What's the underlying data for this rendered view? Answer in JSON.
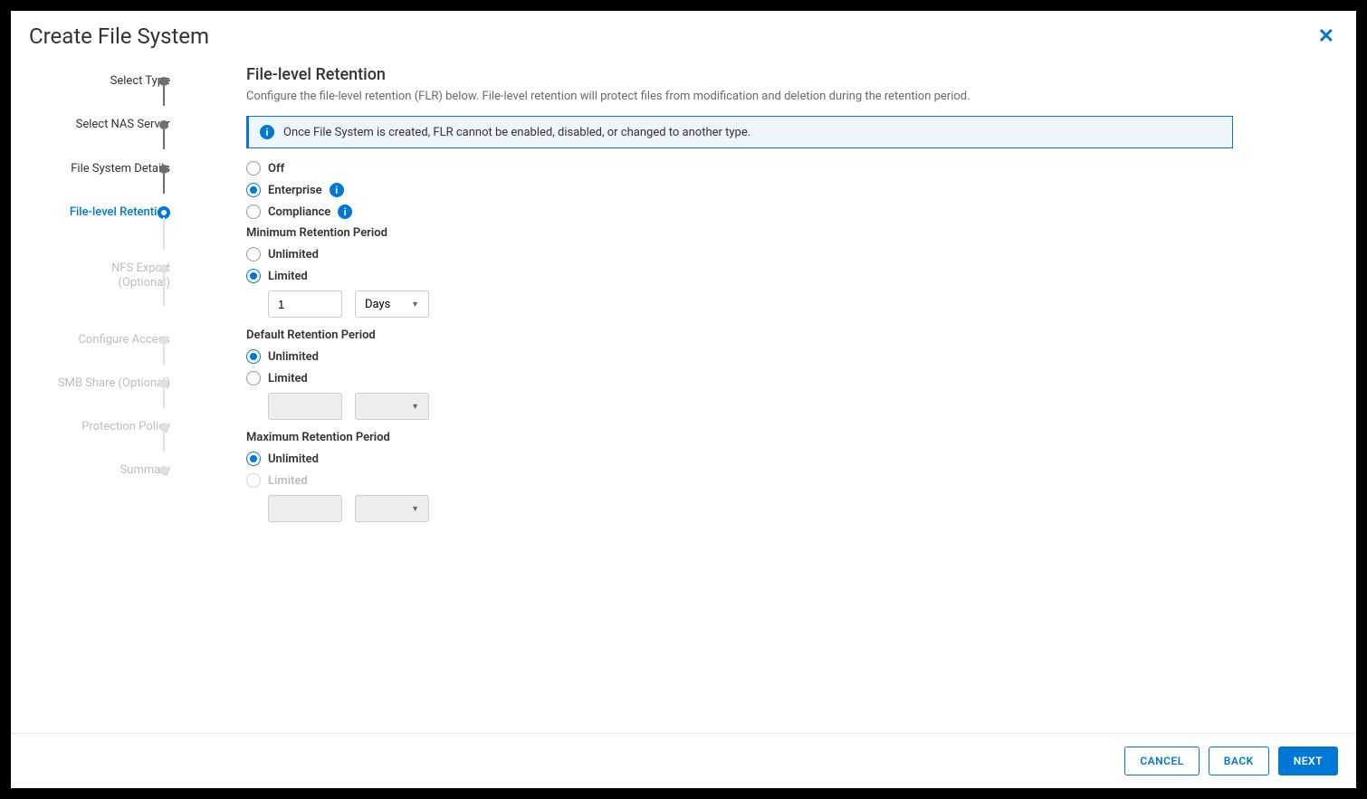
{
  "dialog": {
    "title": "Create File System"
  },
  "steps": [
    {
      "label": "Select Type"
    },
    {
      "label": "Select NAS Server"
    },
    {
      "label": "File System Details"
    },
    {
      "label": "File-level Retention"
    },
    {
      "label": "NFS Export (Optional)"
    },
    {
      "label": "Configure Access"
    },
    {
      "label": "SMB Share (Optional)"
    },
    {
      "label": "Protection Policy"
    },
    {
      "label": "Summary"
    }
  ],
  "content": {
    "heading": "File-level Retention",
    "subtitle": "Configure the file-level retention (FLR) below. File-level retention will protect files from modification and deletion during the retention period.",
    "banner": "Once File System is created, FLR cannot be enabled, disabled, or changed to another type.",
    "flr_options": {
      "off": "Off",
      "enterprise": "Enterprise",
      "compliance": "Compliance"
    },
    "sections": {
      "min_label": "Minimum Retention Period",
      "def_label": "Default Retention Period",
      "max_label": "Maximum Retention Period",
      "unlimited": "Unlimited",
      "limited": "Limited"
    },
    "min_value": "1",
    "min_unit": "Days"
  },
  "footer": {
    "cancel": "CANCEL",
    "back": "BACK",
    "next": "NEXT"
  }
}
